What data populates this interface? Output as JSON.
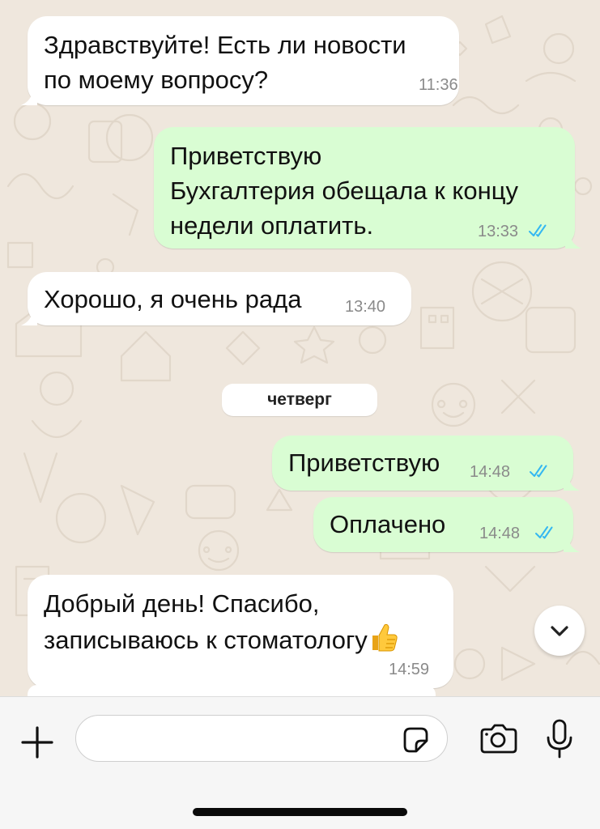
{
  "messages": [
    {
      "direction": "incoming",
      "lines": [
        "Здравствуйте! Есть ли новости",
        "по моему вопросу?"
      ],
      "time": "11:36"
    },
    {
      "direction": "outgoing",
      "lines": [
        "Приветствую",
        "Бухгалтерия обещала к концу",
        "недели оплатить."
      ],
      "time": "13:33",
      "status": "read"
    },
    {
      "direction": "incoming",
      "lines": [
        "Хорошо, я очень рада"
      ],
      "time": "13:40"
    },
    {
      "direction": "outgoing",
      "lines": [
        "Приветствую"
      ],
      "time": "14:48",
      "status": "read"
    },
    {
      "direction": "outgoing",
      "lines": [
        "Оплачено"
      ],
      "time": "14:48",
      "status": "read"
    },
    {
      "direction": "incoming",
      "lines": [
        "Добрый день! Спасибо,",
        "записываюсь к стоматологу"
      ],
      "emoji": "thumbs-up",
      "time": "14:59"
    }
  ],
  "day_separator": "четверг",
  "input": {
    "placeholder": "",
    "value": ""
  },
  "icons": {
    "attach": "plus-icon",
    "sticker": "sticker-icon",
    "camera": "camera-icon",
    "mic": "microphone-icon",
    "scroll": "chevron-down-icon",
    "read_receipt": "double-check-icon"
  },
  "colors": {
    "background": "#efe7dd",
    "incoming_bubble": "#ffffff",
    "outgoing_bubble": "#d9fdd3",
    "read_ticks": "#34b7f1",
    "time_text": "#8a8a8a"
  }
}
